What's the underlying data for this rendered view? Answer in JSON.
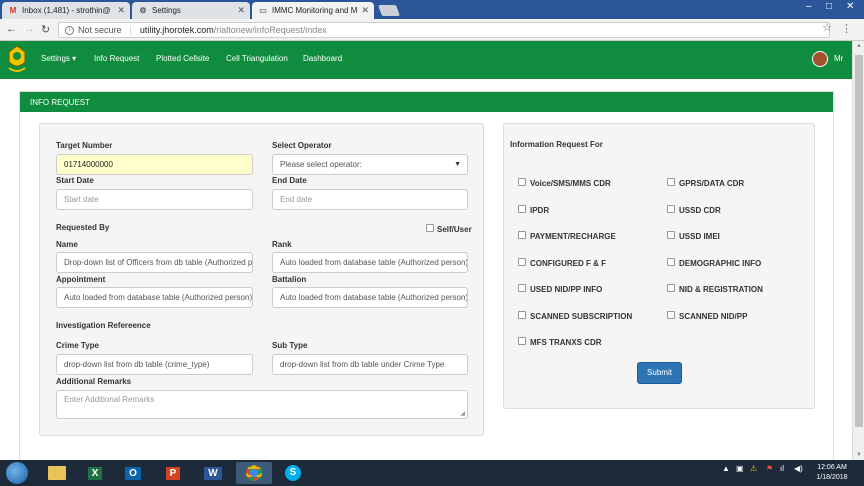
{
  "browser": {
    "tabs": [
      {
        "title": "Inbox (1,481) - strothin@",
        "icon": "gmail-icon"
      },
      {
        "title": "Settings",
        "icon": "gear-icon"
      },
      {
        "title": "IMMC Monitoring and M",
        "icon": "page-icon"
      }
    ],
    "security": "Not secure",
    "url_host": "utility.jhorotek.com",
    "url_path": "/rialtonew/infoRequest/index"
  },
  "navbar": {
    "items": [
      "Settings",
      "Info Request",
      "Plotted Cellsite",
      "Cell Triangulation",
      "Dashboard"
    ],
    "user": "Mr"
  },
  "panel": {
    "title": "INFO REQUEST"
  },
  "form": {
    "target_number_label": "Target Number",
    "target_number_value": "01714000000",
    "select_operator_label": "Select Operator",
    "select_operator_value": "Please select operator:",
    "start_date_label": "Start Date",
    "start_date_placeholder": "Start date",
    "end_date_label": "End Date",
    "end_date_placeholder": "End date",
    "requested_by_label": "Requested By",
    "self_user_label": "Self/User",
    "name_label": "Name",
    "name_value": "Drop-down list of Officers from db table (Authorized pe",
    "rank_label": "Rank",
    "rank_value": "Auto loaded from database table (Authorized person)",
    "appointment_label": "Appointment",
    "appointment_value": "Auto loaded from database table (Authorized person)",
    "battalion_label": "Battalion",
    "battalion_value": "Auto loaded from database table (Authorized person)",
    "investigation_label": "Investigation Refereence",
    "crime_type_label": "Crime Type",
    "crime_type_value": "drop-down list from db table (crime_type)",
    "sub_type_label": "Sub Type",
    "sub_type_value": "drop-down list from db table under Crime Type",
    "remarks_label": "Additional Remarks",
    "remarks_placeholder": "Enter Additional Remarks"
  },
  "info_request": {
    "title": "Information Request For",
    "left": [
      "Voice/SMS/MMS CDR",
      "IPDR",
      "PAYMENT/RECHARGE",
      "CONFIGURED F & F",
      "USED NID/PP INFO",
      "SCANNED SUBSCRIPTION",
      "MFS TRANXS CDR"
    ],
    "right": [
      "GPRS/DATA CDR",
      "USSD CDR",
      "USSD IMEI",
      "DEMOGRAPHIC INFO",
      "NID & REGISTRATION",
      "SCANNED NID/PP"
    ],
    "submit_label": "Submit"
  },
  "taskbar": {
    "apps": [
      {
        "label": "",
        "icon": "file-explorer-icon",
        "color": "#e8c35a"
      },
      {
        "label": "X",
        "icon": "excel-icon",
        "color": "#1e7145"
      },
      {
        "label": "O",
        "icon": "outlook-icon",
        "color": "#0a64ad"
      },
      {
        "label": "P",
        "icon": "powerpoint-icon",
        "color": "#d04423"
      },
      {
        "label": "W",
        "icon": "word-icon",
        "color": "#2b579a"
      },
      {
        "label": "",
        "icon": "chrome-icon",
        "color": "#3d5a78"
      },
      {
        "label": "S",
        "icon": "skype-icon",
        "color": "#00aff0"
      }
    ],
    "time": "12:06 AM",
    "date": "1/18/2018"
  },
  "colors": {
    "brand_green": "#0f8c3e",
    "submit_blue": "#2e75b6",
    "highlight_yellow": "#ffffcc"
  }
}
